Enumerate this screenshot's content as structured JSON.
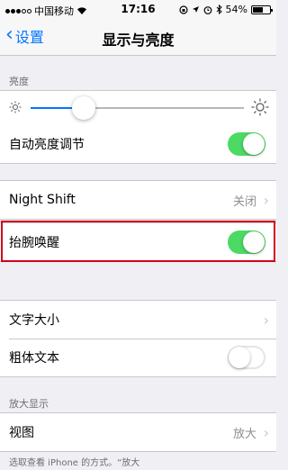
{
  "status_bar": {
    "carrier": "中国移动",
    "time": "17:16",
    "battery": "54%",
    "battery_level": 0.54
  },
  "nav": {
    "back_label": "设置",
    "title": "显示与亮度"
  },
  "brightness_section": {
    "header": "亮度",
    "slider_level": 0.25,
    "auto_brightness_label": "自动亮度调节",
    "auto_brightness_on": true
  },
  "night_shift": {
    "label": "Night Shift",
    "value": "关闭"
  },
  "raise_to_wake": {
    "label": "抬腕唤醒",
    "on": true
  },
  "text_section": {
    "text_size_label": "文字大小",
    "bold_text_label": "粗体文本",
    "bold_text_on": false
  },
  "zoom_section": {
    "header": "放大显示",
    "view_label": "视图",
    "view_value": "放大"
  },
  "footer_note": "选取查看 iPhone 的方式。“放大",
  "colors": {
    "accent": "#0076ff",
    "toggle_on": "#4cd964",
    "highlight_border": "#d0021b",
    "background": "#efeff4"
  }
}
